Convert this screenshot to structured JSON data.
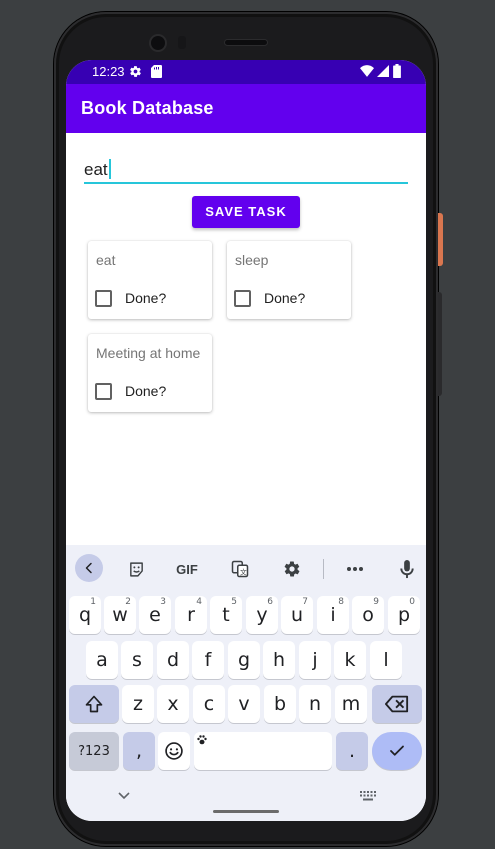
{
  "status_bar": {
    "time": "12:23",
    "icons": [
      "settings-icon",
      "sd-card-icon",
      "wifi-icon",
      "signal-icon",
      "battery-icon"
    ]
  },
  "app_bar": {
    "title": "Book Database"
  },
  "task_input": {
    "value": "eat"
  },
  "save_button": {
    "label": "SAVE TASK"
  },
  "tasks": [
    {
      "title": "eat",
      "checkbox_label": "Done?",
      "checked": false
    },
    {
      "title": "sleep",
      "checkbox_label": "Done?",
      "checked": false
    },
    {
      "title": "Meeting at home",
      "checkbox_label": "Done?",
      "checked": false
    }
  ],
  "keyboard": {
    "toolbar": [
      "back-icon",
      "sticker-icon",
      "GIF",
      "translate-icon",
      "settings-icon",
      "more-icon",
      "mic-icon"
    ],
    "row1": [
      {
        "k": "q",
        "h": "1"
      },
      {
        "k": "w",
        "h": "2"
      },
      {
        "k": "e",
        "h": "3"
      },
      {
        "k": "r",
        "h": "4"
      },
      {
        "k": "t",
        "h": "5"
      },
      {
        "k": "y",
        "h": "6"
      },
      {
        "k": "u",
        "h": "7"
      },
      {
        "k": "i",
        "h": "8"
      },
      {
        "k": "o",
        "h": "9"
      },
      {
        "k": "p",
        "h": "0"
      }
    ],
    "row2": [
      "a",
      "s",
      "d",
      "f",
      "g",
      "h",
      "j",
      "k",
      "l"
    ],
    "row3": [
      "z",
      "x",
      "c",
      "v",
      "b",
      "n",
      "m"
    ],
    "symbols_label": "?123",
    "comma": ",",
    "period": "."
  },
  "colors": {
    "primary": "#6200ee",
    "primary_dark": "#3700b3",
    "accent": "#26c6da"
  }
}
